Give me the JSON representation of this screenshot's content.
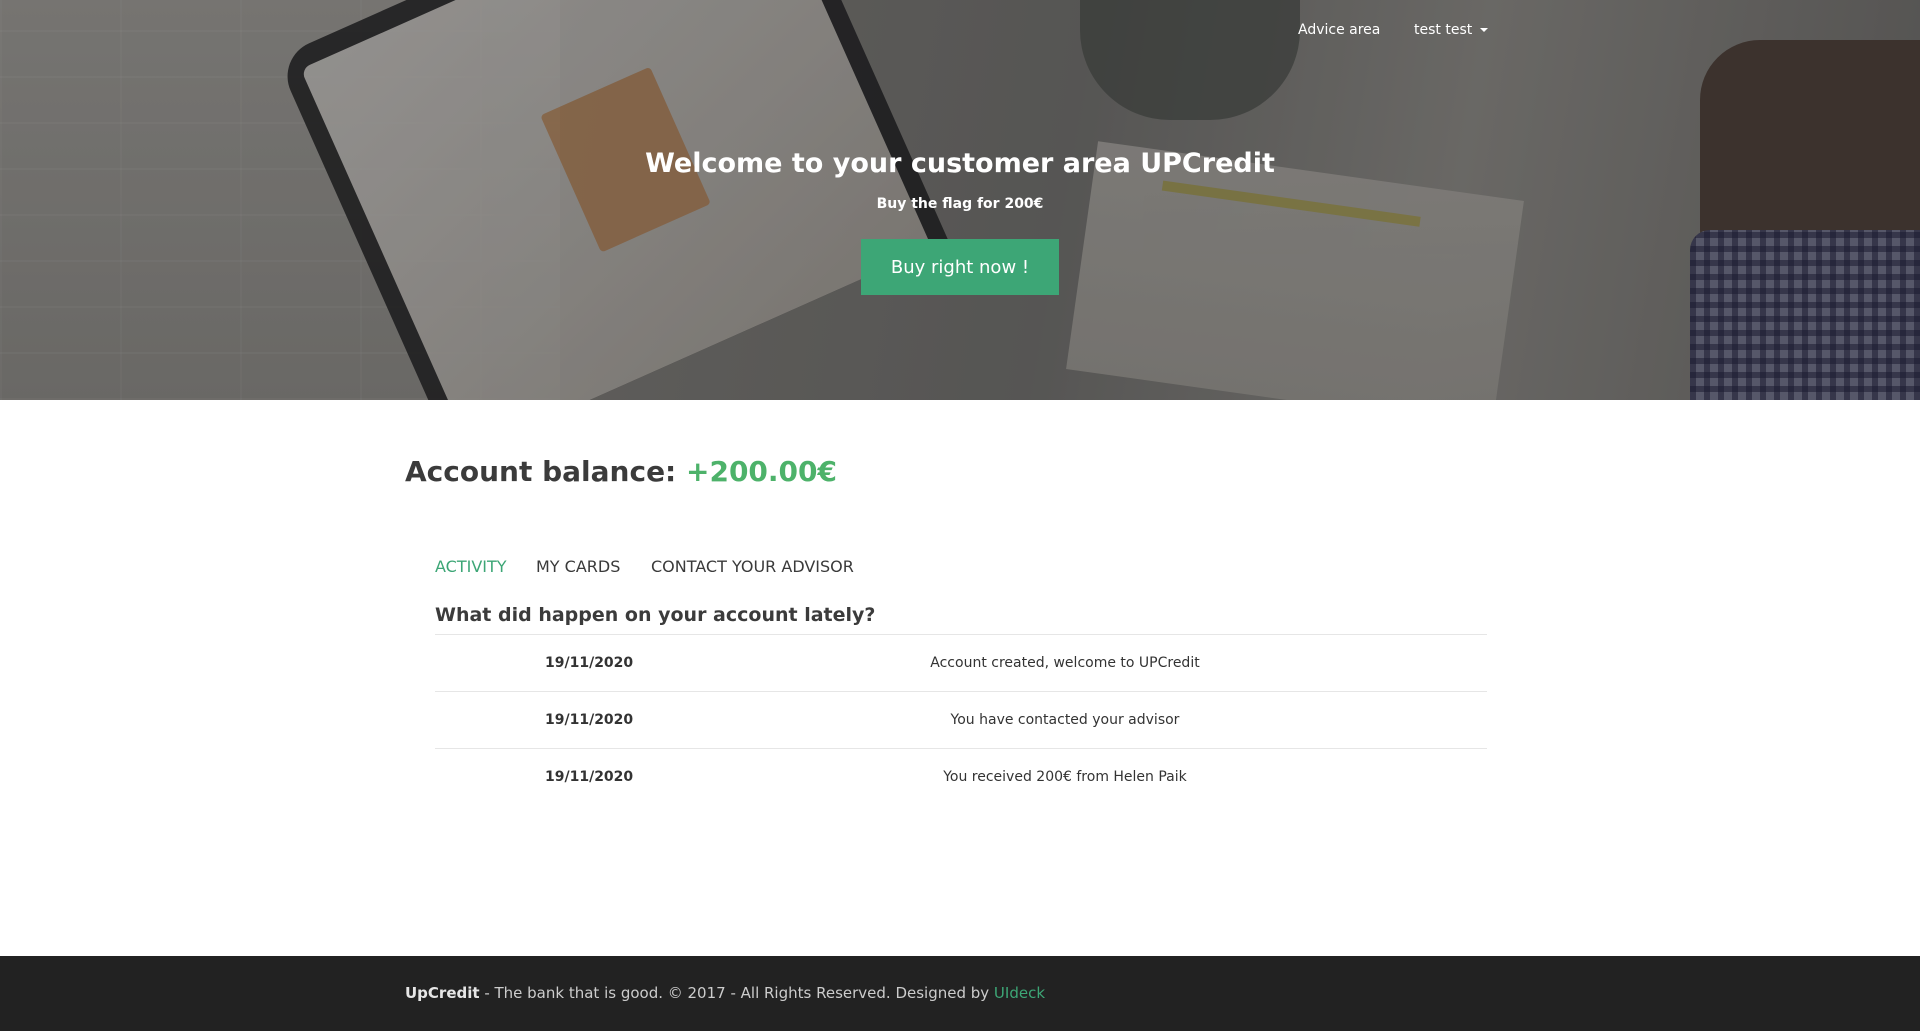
{
  "nav": {
    "advice_label": "Advice area",
    "user_label": "test test"
  },
  "hero": {
    "title": "Welcome to your customer area UPCredit",
    "subtitle": "Buy the flag for 200€",
    "button_label": "Buy right now !"
  },
  "balance": {
    "label": "Account balance:",
    "value": "+200.00€",
    "value_color": "#4db26a"
  },
  "tabs": [
    {
      "label": "ACTIVITY",
      "active": true
    },
    {
      "label": "MY CARDS",
      "active": false
    },
    {
      "label": "CONTACT YOUR ADVISOR",
      "active": false
    }
  ],
  "activity": {
    "title": "What did happen on your account lately?",
    "rows": [
      {
        "date": "19/11/2020",
        "description": "Account created, welcome to UPCredit"
      },
      {
        "date": "19/11/2020",
        "description": "You have contacted your advisor"
      },
      {
        "date": "19/11/2020",
        "description": "You received 200€ from Helen Paik"
      }
    ]
  },
  "footer": {
    "brand": "UpCredit",
    "text": " - The bank that is good. © 2017 - All Rights Reserved. Designed by ",
    "link_label": "UIdeck"
  },
  "colors": {
    "accent": "#3da676",
    "footer_bg": "#222222"
  }
}
